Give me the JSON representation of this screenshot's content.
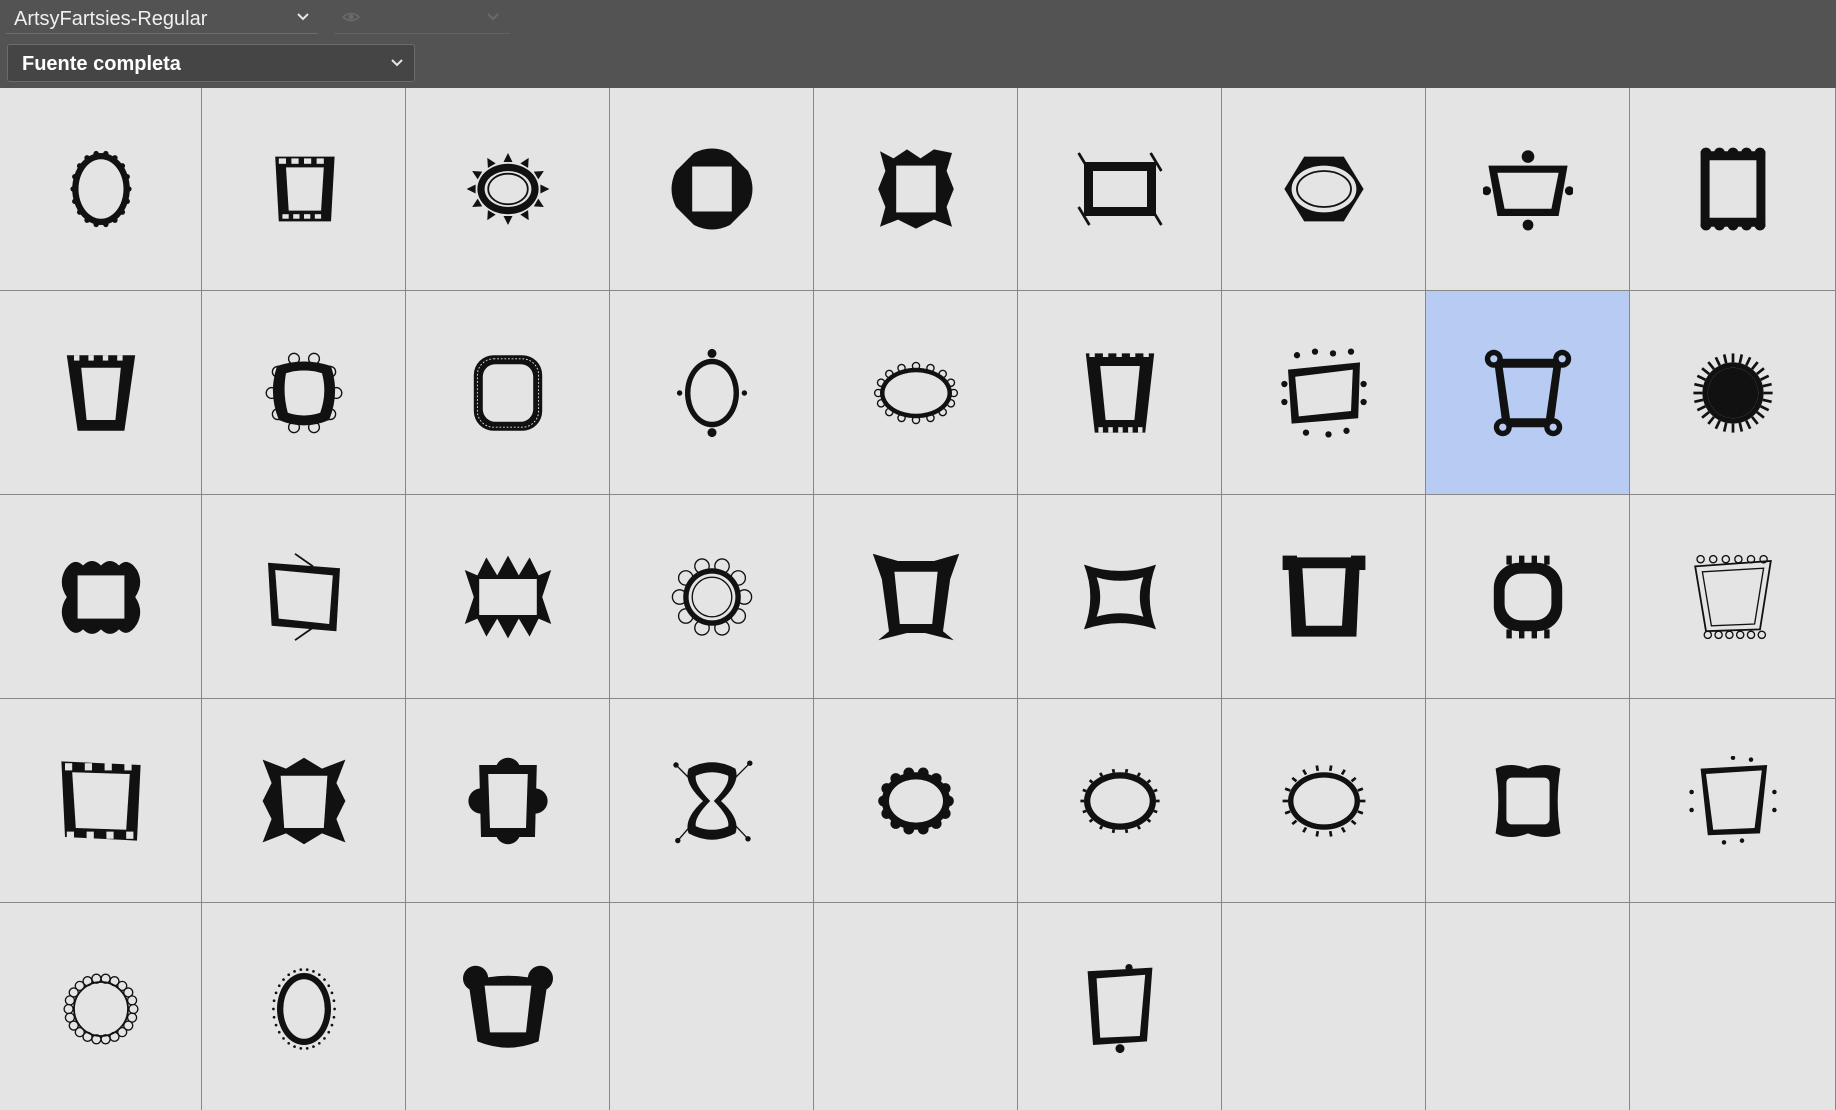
{
  "toolbar": {
    "font_name": "ArtsyFartsies-Regular",
    "font_style": "",
    "subset": "Fuente completa"
  },
  "icons": {
    "chevron": "chevron-down-icon",
    "visibility": "eye-icon"
  },
  "colors": {
    "panel_bg": "#535353",
    "cell_bg": "#e4e4e5",
    "selected_bg": "#b8cbf2",
    "grid_line": "#888888",
    "glyph": "#111111"
  },
  "glyph_grid": {
    "columns": 9,
    "rows": 5,
    "selected_index": 16,
    "glyphs": [
      "oval-frame",
      "greek-key-frame",
      "sunburst-oval-frame",
      "ornate-square-frame",
      "spiky-square-frame",
      "crossed-corner-frame",
      "notched-oval-frame",
      "fleuron-trapezoid-frame",
      "scalloped-rect-frame",
      "castle-trapezoid-frame",
      "swirl-frame",
      "rounded-square-frame",
      "beaded-oval-frame",
      "petal-oval-frame",
      "castle-tall-frame",
      "dotted-antenna-frame",
      "knob-corner-frame",
      "rayed-circle-frame",
      "wavy-square-frame",
      "corner-ray-frame",
      "zigzag-rect-frame",
      "gear-circle-frame",
      "pointed-corner-frame",
      "pillow-frame",
      "tabbed-rect-frame",
      "notched-round-frame",
      "loopy-trapezoid-frame",
      "square-corner-frame",
      "argyle-frame",
      "cloud-corner-frame",
      "hourglass-frame",
      "scalloped-circle-frame",
      "turret-oval-frame",
      "dotted-ray-oval-frame",
      "star-corner-frame",
      "dotted-stick-frame",
      "loop-ring-frame",
      "dotted-oval-frame",
      "ear-trapezoid-frame",
      "empty",
      "empty",
      "bead-hang-frame",
      "empty",
      "empty",
      "empty"
    ]
  }
}
